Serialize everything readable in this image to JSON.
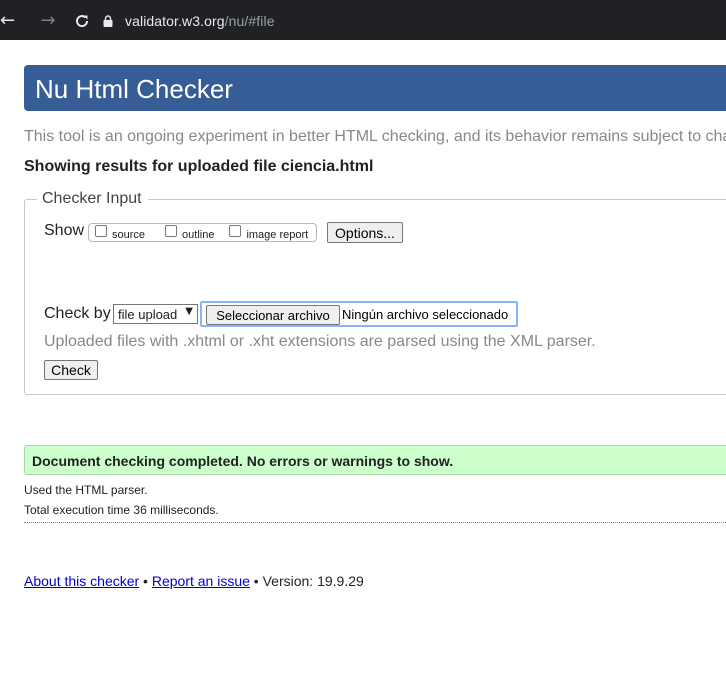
{
  "browser": {
    "back_icon": "arrow-left-icon",
    "forward_icon": "arrow-right-icon",
    "reload_icon": "reload-icon",
    "lock_icon": "lock-icon",
    "url_host": "validator.w3.org",
    "url_path": "/nu/#file"
  },
  "header": {
    "title": "Nu Html Checker",
    "bar_color": "#365d95"
  },
  "intro_text": "This tool is an ongoing experiment in better HTML checking, and its behavior remains subject to cha",
  "results_heading": "Showing results for uploaded file ciencia.html",
  "checker": {
    "legend": "Checker Input",
    "show_label": "Show",
    "show_options": [
      {
        "label": "source",
        "checked": false
      },
      {
        "label": "outline",
        "checked": false
      },
      {
        "label": "image report",
        "checked": false
      }
    ],
    "options_button": "Options...",
    "check_by_label": "Check by",
    "check_by_selected": "file upload",
    "file_button": "Seleccionar archivo",
    "file_status": "Ningún archivo seleccionado",
    "upload_note": "Uploaded files with .xhtml or .xht extensions are parsed using the XML parser.",
    "check_button": "Check"
  },
  "result": {
    "success_message": "Document checking completed. No errors or warnings to show.",
    "success_color": "#ccffcc",
    "parser_note": "Used the HTML parser.",
    "time_note": "Total execution time 36 milliseconds."
  },
  "footer": {
    "about_link": "About this checker",
    "sep1": " • ",
    "report_link": "Report an issue",
    "version_text": " • Version: 19.9.29"
  }
}
